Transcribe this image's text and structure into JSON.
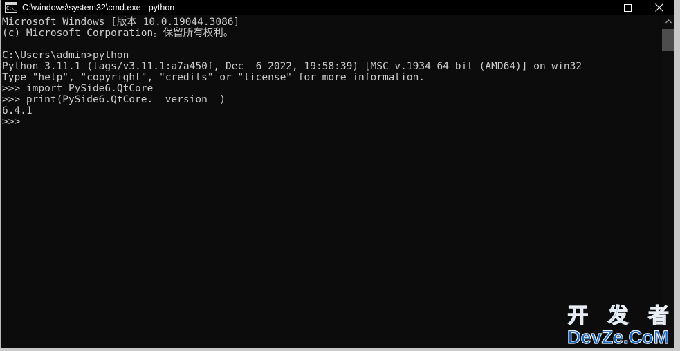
{
  "window": {
    "title": "C:\\windows\\system32\\cmd.exe - python",
    "icon": "cmd-console-icon",
    "icon_glyph": "C:\\_",
    "background_color": "#0c0c0c",
    "titlebar_color": "#000000",
    "text_color": "#cccccc"
  },
  "controls": {
    "minimize": "minimize-icon",
    "maximize": "maximize-icon",
    "close": "close-icon"
  },
  "console": {
    "lines": [
      "Microsoft Windows [版本 10.0.19044.3086]",
      "(c) Microsoft Corporation。保留所有权利。",
      "",
      "C:\\Users\\admin>python",
      "Python 3.11.1 (tags/v3.11.1:a7a450f, Dec  6 2022, 19:58:39) [MSC v.1934 64 bit (AMD64)] on win32",
      "Type \"help\", \"copyright\", \"credits\" or \"license\" for more information.",
      ">>> import PySide6.QtCore",
      ">>> print(PySide6.QtCore.__version__)",
      "6.4.1",
      ">>>"
    ]
  },
  "scrollbar": {
    "up_arrow": "chevron-up-icon",
    "thumb": "scrollbar-thumb"
  },
  "watermark": {
    "chinese": "开 发 者",
    "latin": "DevZe.CoM",
    "color": "#1565c0"
  }
}
